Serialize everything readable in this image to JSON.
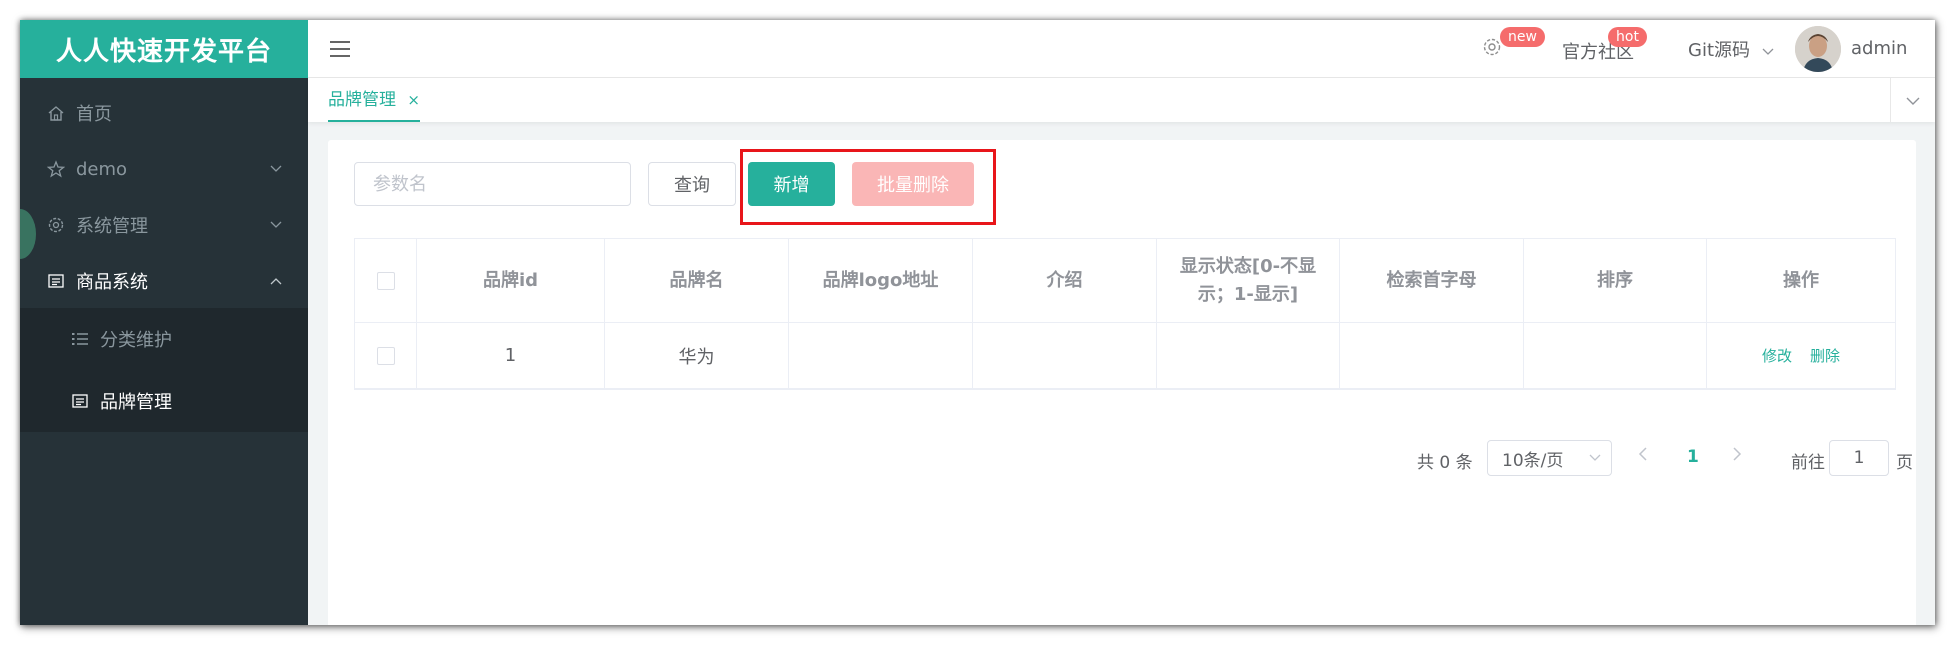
{
  "app": {
    "title": "人人快速开发平台"
  },
  "sidebar": {
    "items": [
      {
        "label": "首页",
        "icon": "home-icon"
      },
      {
        "label": "demo",
        "icon": "star-icon"
      },
      {
        "label": "系统管理",
        "icon": "gear-icon"
      },
      {
        "label": "商品系统",
        "icon": "list-box-icon",
        "open": true
      }
    ],
    "submenu": [
      {
        "label": "分类维护",
        "icon": "list-icon"
      },
      {
        "label": "品牌管理",
        "icon": "list-box-icon",
        "active": true
      }
    ]
  },
  "header": {
    "new_badge": "new",
    "community": "官方社区",
    "hot_badge": "hot",
    "git": "Git源码",
    "user": "admin"
  },
  "tabs": [
    {
      "label": "品牌管理",
      "close": "×"
    }
  ],
  "toolbar": {
    "search_placeholder": "参数名",
    "query": "查询",
    "add": "新增",
    "batch_delete": "批量删除"
  },
  "table": {
    "headers": [
      "品牌id",
      "品牌名",
      "品牌logo地址",
      "介绍",
      "显示状态[0-不显示；1-显示]",
      "检索首字母",
      "排序",
      "操作"
    ],
    "header_status_lines": [
      "显示状态[0-不显",
      "示；1-显示]"
    ],
    "rows": [
      {
        "id": "1",
        "name": "华为",
        "logo": "",
        "intro": "",
        "status": "",
        "first_letter": "",
        "sort": ""
      }
    ],
    "actions": {
      "edit": "修改",
      "delete": "删除"
    }
  },
  "pagination": {
    "total": "共 0 条",
    "page_size": "10条/页",
    "current_page": "1",
    "goto_prefix": "前往",
    "goto_value": "1",
    "goto_suffix": "页"
  },
  "colors": {
    "brand": "#26b09c",
    "sidebar": "#263238",
    "danger_disabled": "#fab6b6",
    "badge": "#f56c6c",
    "highlight": "#e8151a"
  }
}
